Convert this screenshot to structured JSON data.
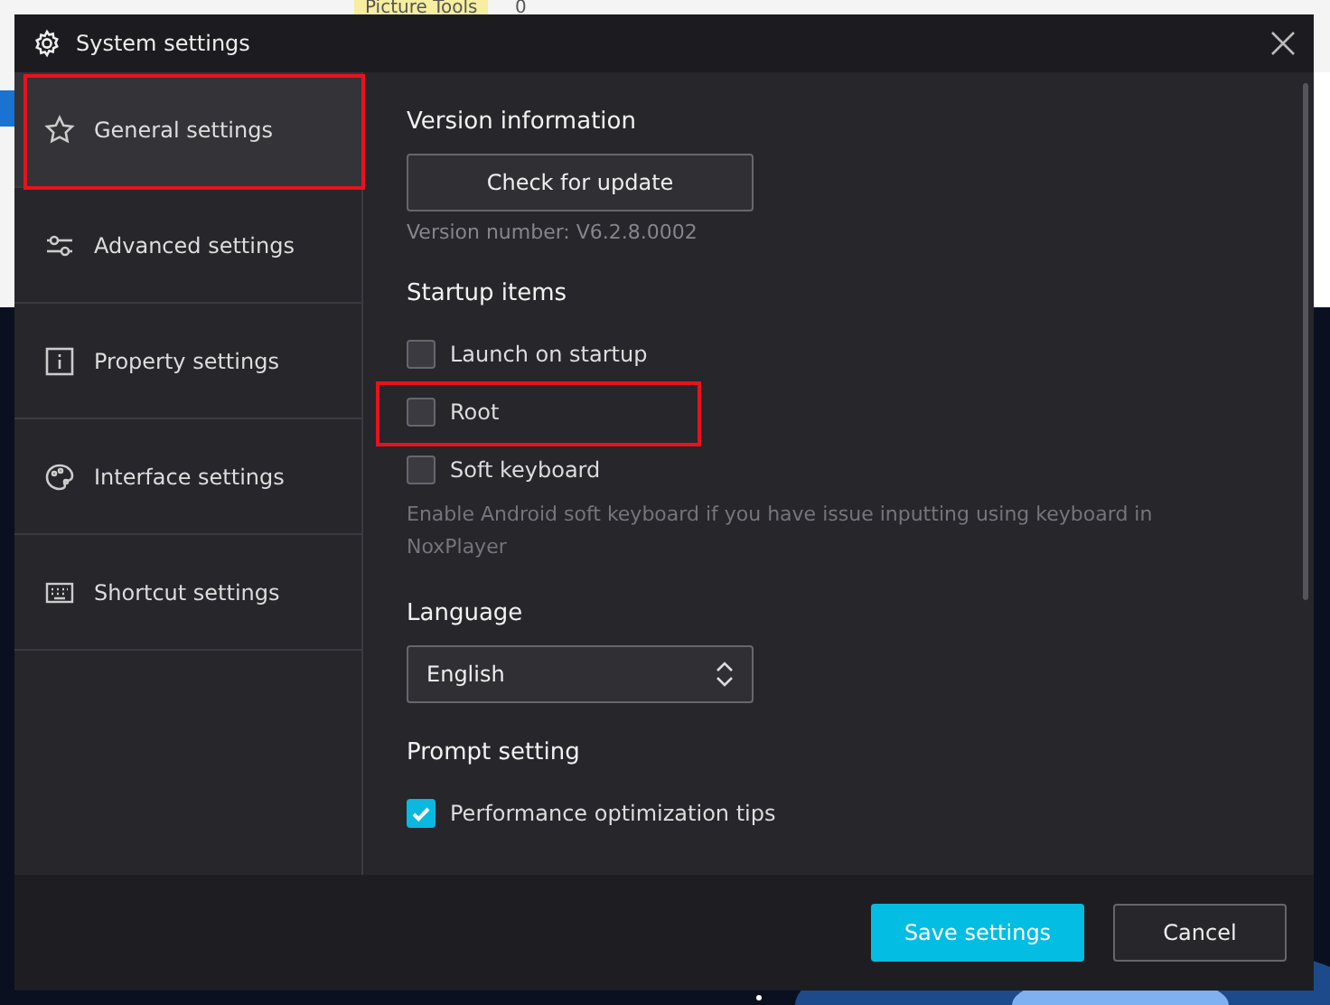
{
  "backdrop": {
    "ribbon_tab": "Picture Tools",
    "counter": "0"
  },
  "window": {
    "title": "System settings"
  },
  "sidebar": {
    "items": [
      {
        "label": "General settings",
        "kind": "star",
        "selected": true,
        "annotated": true
      },
      {
        "label": "Advanced settings",
        "kind": "sliders",
        "selected": false,
        "annotated": false
      },
      {
        "label": "Property settings",
        "kind": "info",
        "selected": false,
        "annotated": false
      },
      {
        "label": "Interface settings",
        "kind": "palette",
        "selected": false,
        "annotated": false
      },
      {
        "label": "Shortcut settings",
        "kind": "keyboard",
        "selected": false,
        "annotated": false
      }
    ]
  },
  "sections": [
    {
      "kind": "version",
      "heading": "Version information",
      "button": "Check for update",
      "note": "Version number: V6.2.8.0002"
    },
    {
      "kind": "checks",
      "heading": "Startup items",
      "items": [
        {
          "label": "Launch on startup",
          "checked": false,
          "annotated": false
        },
        {
          "label": "Root",
          "checked": false,
          "annotated": true
        },
        {
          "label": "Soft keyboard",
          "checked": false,
          "annotated": false,
          "hint": "Enable Android soft keyboard if you have issue inputting using keyboard in NoxPlayer"
        }
      ]
    },
    {
      "kind": "select",
      "heading": "Language",
      "value": "English"
    },
    {
      "kind": "checks",
      "heading": "Prompt setting",
      "items": [
        {
          "label": "Performance optimization tips",
          "checked": true,
          "annotated": false
        }
      ]
    }
  ],
  "footer": {
    "buttons": [
      {
        "label": "Save settings",
        "kind": "primary"
      },
      {
        "label": "Cancel",
        "kind": "secondary"
      }
    ]
  }
}
